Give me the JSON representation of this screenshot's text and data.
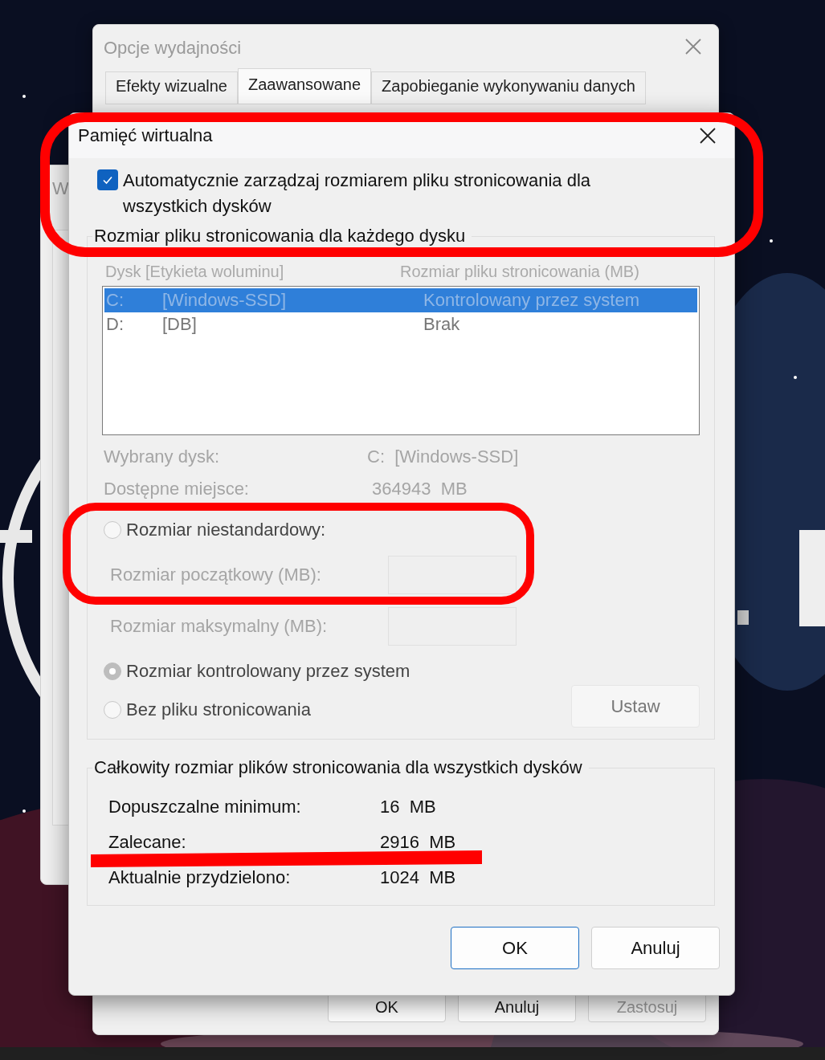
{
  "background_window": {
    "title_fragment": "W"
  },
  "parent_window": {
    "title": "Opcje wydajności",
    "tabs": [
      {
        "label": "Efekty wizualne",
        "selected": false
      },
      {
        "label": "Zaawansowane",
        "selected": true
      },
      {
        "label": "Zapobieganie wykonywaniu danych",
        "selected": false
      }
    ],
    "buttons": [
      {
        "label": "OK",
        "disabled": false
      },
      {
        "label": "Anuluj",
        "disabled": false
      },
      {
        "label": "Zastosuj",
        "disabled": true
      }
    ]
  },
  "dialog": {
    "title": "Pamięć wirtualna",
    "auto_manage": {
      "label": "Automatycznie zarządzaj rozmiarem pliku stronicowania dla wszystkich dysków",
      "checked": true
    },
    "per_drive": {
      "title": "Rozmiar pliku stronicowania dla każdego dysku",
      "disabled": true,
      "columns": [
        "Dysk [Etykieta woluminu]",
        "Rozmiar pliku stronicowania (MB)"
      ],
      "drives": [
        {
          "drive": "C:",
          "label": "[Windows-SSD]",
          "size": "Kontrolowany przez system",
          "selected": true
        },
        {
          "drive": "D:",
          "label": "[DB]",
          "size": "Brak",
          "selected": false
        }
      ],
      "info": [
        {
          "label": "Wybrany dysk:",
          "value": "C:  [Windows-SSD]"
        },
        {
          "label": "Dostępne miejsce:",
          "value": " 364943  MB"
        }
      ],
      "options": [
        {
          "kind": "radio",
          "label": "Rozmiar niestandardowy:",
          "selected": false
        },
        {
          "kind": "field",
          "label": "Rozmiar początkowy (MB):"
        },
        {
          "kind": "field",
          "label": "Rozmiar maksymalny (MB):"
        },
        {
          "kind": "radio",
          "label": "Rozmiar kontrolowany przez system",
          "selected": true
        },
        {
          "kind": "radio",
          "label": "Bez pliku stronicowania",
          "selected": false
        }
      ],
      "set_button": {
        "label": "Ustaw",
        "disabled": true
      }
    },
    "totals": {
      "title": "Całkowity rozmiar plików stronicowania dla wszystkich dysków",
      "rows": [
        {
          "label": "Dopuszczalne minimum:",
          "value": "16  MB"
        },
        {
          "label": "Zalecane:",
          "value": "2916  MB"
        },
        {
          "label": "Aktualnie przydzielono:",
          "value": "1024  MB"
        }
      ]
    },
    "buttons": [
      {
        "label": "OK",
        "default": true
      },
      {
        "label": "Anuluj",
        "default": false
      }
    ]
  }
}
